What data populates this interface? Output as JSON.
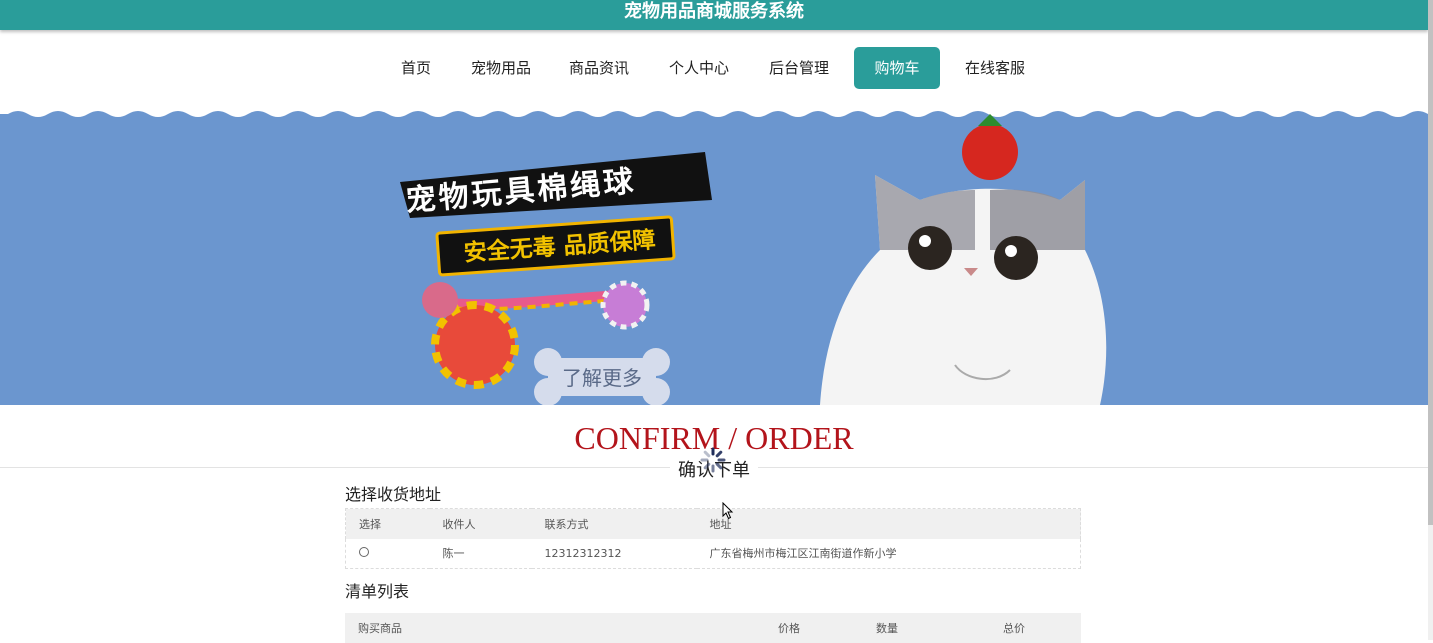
{
  "header": {
    "title": "宠物用品商城服务系统",
    "bg_color": "#2a9d9a"
  },
  "nav": {
    "items": [
      {
        "label": "首页"
      },
      {
        "label": "宠物用品"
      },
      {
        "label": "商品资讯"
      },
      {
        "label": "个人中心"
      },
      {
        "label": "后台管理"
      },
      {
        "label": "购物车",
        "active": true
      },
      {
        "label": "在线客服"
      }
    ]
  },
  "banner": {
    "headline": "宠物玩具棉绳球",
    "subheadline": "安全无毒 品质保障",
    "cta": "了解更多",
    "bg_color": "#6b96cf"
  },
  "section": {
    "title_en": "CONFIRM / ORDER",
    "title_cn": "确认下单"
  },
  "address": {
    "title": "选择收货地址",
    "columns": [
      "选择",
      "收件人",
      "联系方式",
      "地址"
    ],
    "rows": [
      {
        "recipient": "陈一",
        "phone": "12312312312",
        "address": "广东省梅州市梅江区江南街道作新小学",
        "selected": false
      }
    ]
  },
  "order": {
    "title": "清单列表",
    "columns": [
      "购买商品",
      "价格",
      "数量",
      "总价"
    ]
  },
  "colors": {
    "accent": "#2a9d9a",
    "title_red": "#b3141b"
  }
}
